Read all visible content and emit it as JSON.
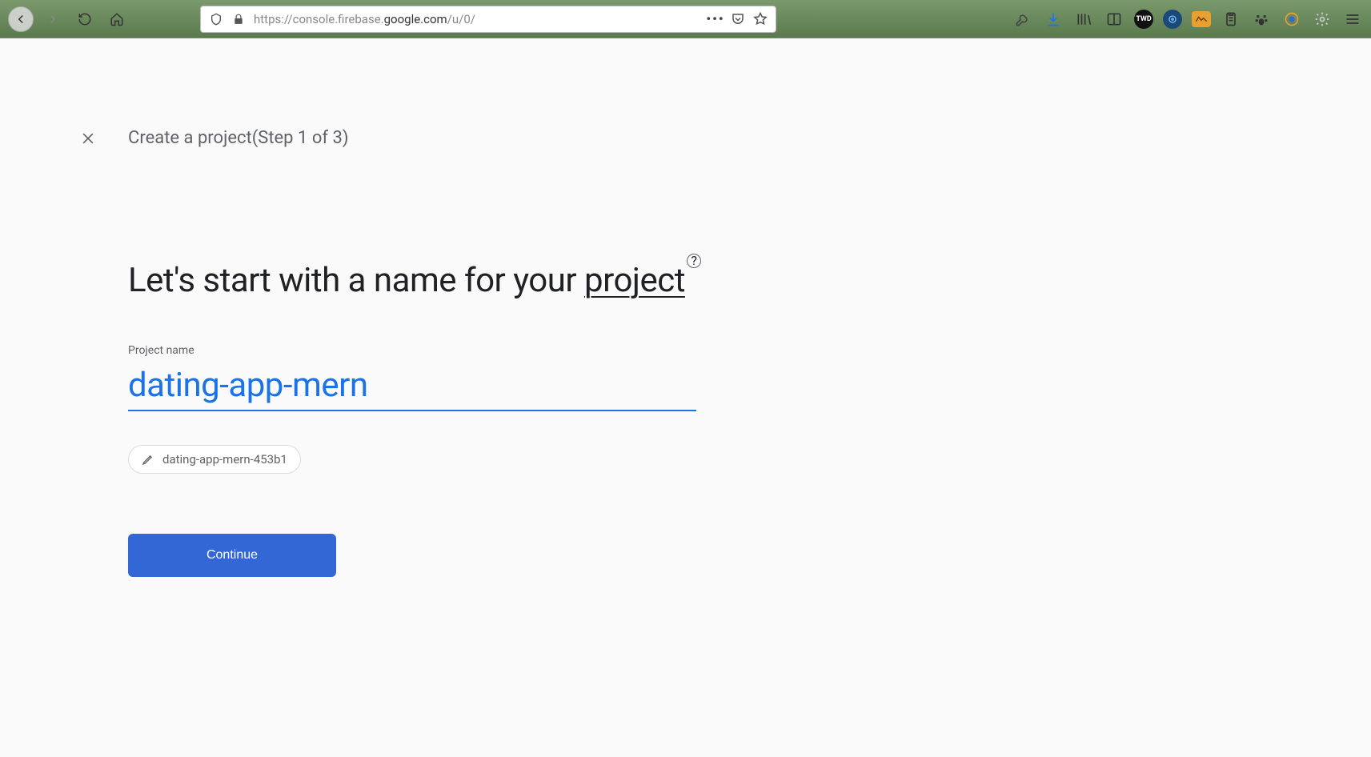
{
  "browser": {
    "url_prefix": "https://console.firebase.",
    "url_highlight": "google.com",
    "url_suffix": "/u/0/"
  },
  "header": {
    "title": "Create a project(Step 1 of 3)"
  },
  "main": {
    "heading_part1": "Let's start with a name for your ",
    "heading_underlined": "project",
    "help_glyph": "?",
    "field_label": "Project name",
    "project_name_value": "dating-app-mern",
    "project_id": "dating-app-mern-453b1",
    "continue_label": "Continue"
  }
}
